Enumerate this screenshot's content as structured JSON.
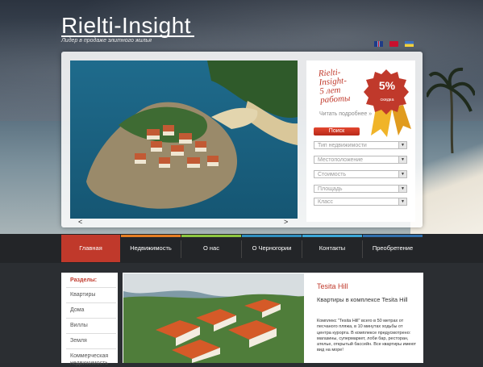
{
  "header": {
    "logo": "Rielti-Insight",
    "tagline": "Лидер в продаже элитного жилья",
    "languages": [
      "en",
      "me",
      "ua"
    ]
  },
  "slider": {
    "prev": "<",
    "next": ">"
  },
  "promo": {
    "title_lines": [
      "Rielti-",
      "Insight-",
      "5 лет",
      "работы"
    ],
    "link": "Читать подробнее »",
    "badge_percent": "5%",
    "badge_label": "скидка"
  },
  "search": {
    "button": "Поиск",
    "selects": [
      "Тип недвижимости",
      "Местоположение",
      "Стоимость",
      "Площадь",
      "Класс"
    ]
  },
  "nav": {
    "items": [
      {
        "label": "Главная",
        "active": true,
        "color": "#c0392b"
      },
      {
        "label": "Недвижимость",
        "active": false,
        "color": "#e67e22"
      },
      {
        "label": "О нас",
        "active": false,
        "color": "#8dc63f"
      },
      {
        "label": "О Черногории",
        "active": false,
        "color": "#2f8fbf"
      },
      {
        "label": "Контакты",
        "active": false,
        "color": "#3aa7d8"
      },
      {
        "label": "Преобретение",
        "active": false,
        "color": "#2f6fad"
      }
    ]
  },
  "sidebar": {
    "heading": "Разделы:",
    "items": [
      "Квартиры",
      "Дома",
      "Виллы",
      "Земля",
      "Коммерческая недвижимость"
    ]
  },
  "featured": {
    "title": "Tesita Hill",
    "subtitle": "Квартиры в комплексе Tesita Hill",
    "text": "Комплекс \"Tesita Hill\" всего в 50 метрах от песчаного пляжа, в 10 минутах ходьбы от центра курорта. В комплексе предусмотрено: магазины, супермаркет, лоби бар, ресторан, ателье, открытый бассейн. Все квартиры имеют вид на море!"
  }
}
